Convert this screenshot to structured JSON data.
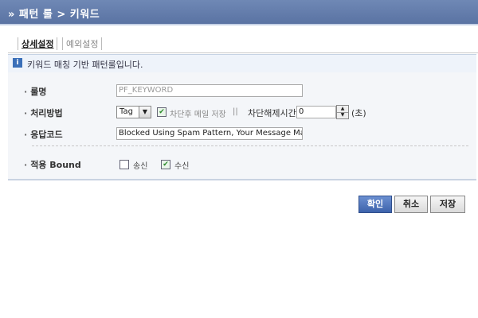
{
  "header": {
    "breadcrumb": "» 패턴 룰 > 키워드"
  },
  "tabs": [
    {
      "label": "상세설정",
      "active": true
    },
    {
      "label": "예외설정",
      "active": false
    }
  ],
  "info": {
    "icon": "info-icon",
    "message": "키워드 매칭 기반 패턴룰입니다."
  },
  "form": {
    "rule_name": {
      "label": "룰명",
      "placeholder": "PF_KEYWORD",
      "value": ""
    },
    "processing": {
      "label": "처리방법",
      "method_selected": "Tag",
      "save_after_block_label": "차단후 메일 저장",
      "save_after_block_checked": true,
      "separator": "||",
      "unblock_time_label": "차단해제시간",
      "unblock_time_value": "0",
      "unblock_time_unit": "(초)"
    },
    "response_code": {
      "label": "응답코드",
      "value": "Blocked Using Spam Pattern, Your Message May C"
    },
    "bound": {
      "label": "적용 Bound",
      "send_label": "송신",
      "send_checked": false,
      "receive_label": "수신",
      "receive_checked": true
    }
  },
  "buttons": {
    "confirm": "확인",
    "cancel": "취소",
    "save": "저장"
  },
  "colors": {
    "header": "#5f78a8",
    "primary_button": "#3d63ab",
    "info_bg": "#eef3fa"
  }
}
